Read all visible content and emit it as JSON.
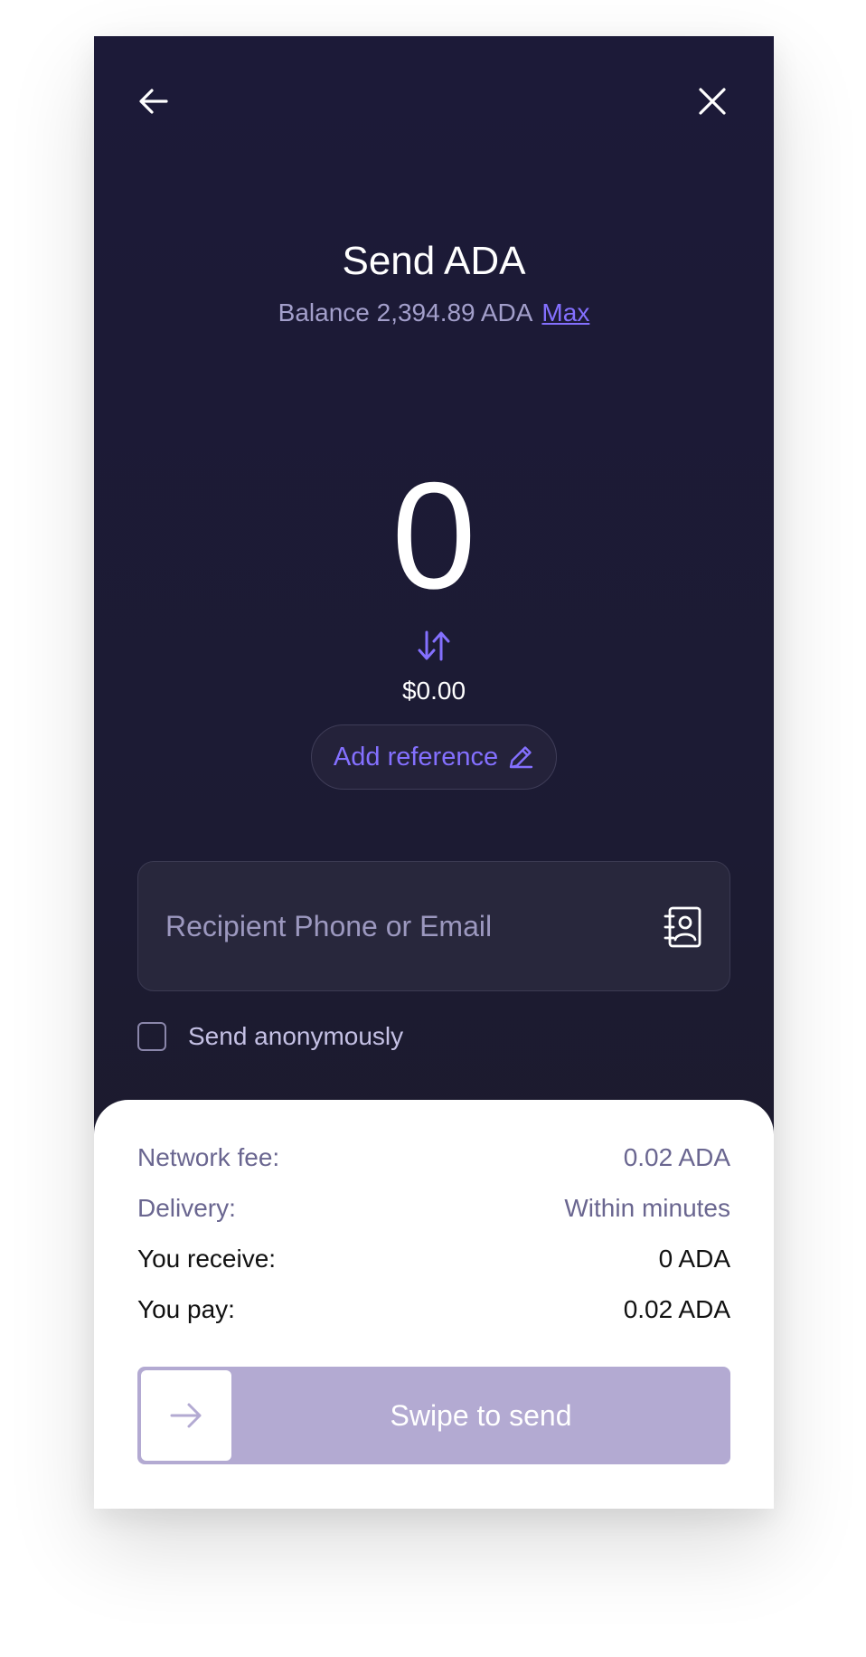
{
  "header": {
    "title": "Send ADA",
    "balance_text": "Balance 2,394.89 ADA",
    "max_label": "Max"
  },
  "amount": {
    "value": "0",
    "fiat": "$0.00"
  },
  "reference": {
    "label": "Add reference"
  },
  "recipient": {
    "placeholder": "Recipient Phone or Email",
    "value": ""
  },
  "anonymous": {
    "label": "Send anonymously",
    "checked": false
  },
  "summary": {
    "network_fee_label": "Network fee:",
    "network_fee_value": "0.02 ADA",
    "delivery_label": "Delivery:",
    "delivery_value": "Within minutes",
    "receive_label": "You receive:",
    "receive_value": "0 ADA",
    "pay_label": "You pay:",
    "pay_value": "0.02 ADA"
  },
  "swipe": {
    "label": "Swipe to send"
  },
  "icons": {
    "back": "arrow-left-icon",
    "close": "close-icon",
    "swap": "swap-arrows-icon",
    "edit": "pencil-icon",
    "contacts": "contacts-book-icon",
    "swipe_arrow": "arrow-right-icon"
  },
  "colors": {
    "background": "#1c1a38",
    "accent": "#8470ff",
    "muted_text": "#a39fcb",
    "swipe_track": "#b3aad2"
  }
}
